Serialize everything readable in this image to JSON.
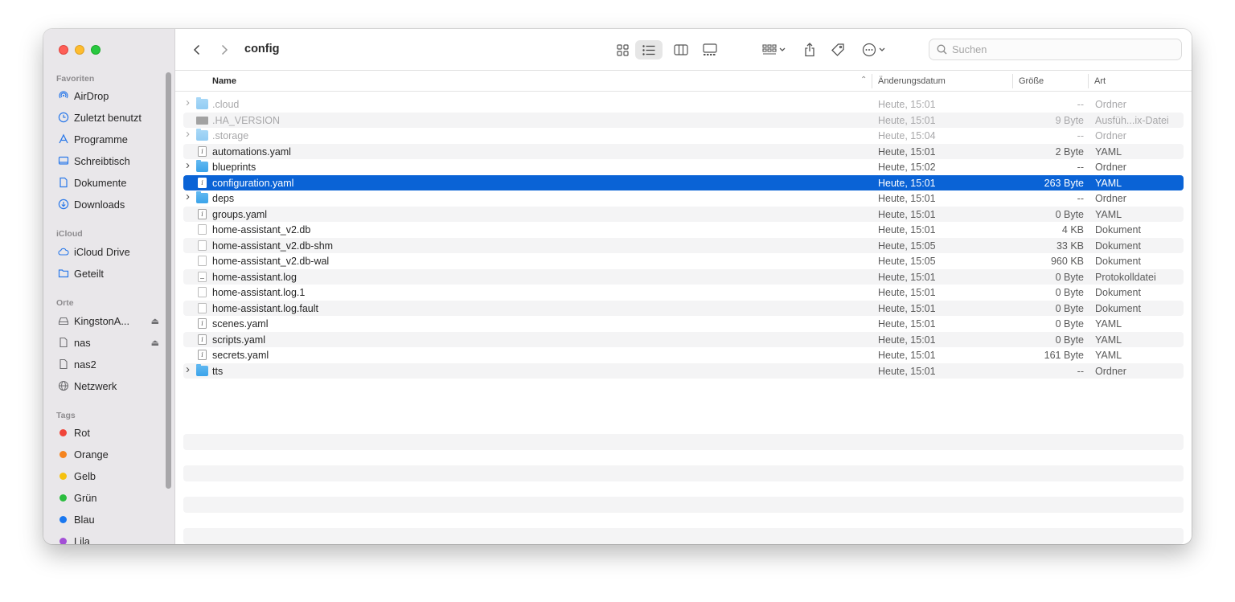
{
  "window": {
    "title": "config"
  },
  "sidebar": {
    "sections": [
      {
        "label": "Favoriten"
      },
      {
        "label": "iCloud"
      },
      {
        "label": "Orte"
      },
      {
        "label": "Tags"
      }
    ],
    "favorites": [
      {
        "label": "AirDrop",
        "icon": "airdrop-icon"
      },
      {
        "label": "Zuletzt benutzt",
        "icon": "clock-icon"
      },
      {
        "label": "Programme",
        "icon": "applications-icon"
      },
      {
        "label": "Schreibtisch",
        "icon": "desktop-icon"
      },
      {
        "label": "Dokumente",
        "icon": "document-icon"
      },
      {
        "label": "Downloads",
        "icon": "download-icon"
      }
    ],
    "icloud": [
      {
        "label": "iCloud Drive",
        "icon": "cloud-icon"
      },
      {
        "label": "Geteilt",
        "icon": "shared-folder-icon"
      }
    ],
    "places": [
      {
        "label": "KingstonA...",
        "icon": "drive-icon"
      },
      {
        "label": "nas",
        "icon": "server-icon"
      },
      {
        "label": "nas2",
        "icon": "server-icon"
      },
      {
        "label": "Netzwerk",
        "icon": "network-icon"
      }
    ],
    "tags": [
      {
        "label": "Rot",
        "color": "#f0453a"
      },
      {
        "label": "Orange",
        "color": "#f5841f"
      },
      {
        "label": "Gelb",
        "color": "#f5c10f"
      },
      {
        "label": "Grün",
        "color": "#2bbd3f"
      },
      {
        "label": "Blau",
        "color": "#1a78f0"
      },
      {
        "label": "Lila",
        "color": "#a34fd6"
      }
    ]
  },
  "toolbar": {
    "back_icon": "chevron-left-icon",
    "forward_icon": "chevron-right-icon",
    "search_placeholder": "Suchen"
  },
  "columns": {
    "name": "Name",
    "date": "Änderungsdatum",
    "size": "Größe",
    "kind": "Art"
  },
  "files": [
    {
      "name": ".cloud",
      "date": "Heute, 15:01",
      "size": "--",
      "kind": "Ordner",
      "type": "folder",
      "hidden": true,
      "expandable": true
    },
    {
      "name": ".HA_VERSION",
      "date": "Heute, 15:01",
      "size": "9 Byte",
      "kind": "Ausfüh...ix-Datei",
      "type": "exec",
      "hidden": true,
      "expandable": false
    },
    {
      "name": ".storage",
      "date": "Heute, 15:04",
      "size": "--",
      "kind": "Ordner",
      "type": "folder",
      "hidden": true,
      "expandable": true
    },
    {
      "name": "automations.yaml",
      "date": "Heute, 15:01",
      "size": "2 Byte",
      "kind": "YAML",
      "type": "yaml",
      "hidden": false,
      "expandable": false
    },
    {
      "name": "blueprints",
      "date": "Heute, 15:02",
      "size": "--",
      "kind": "Ordner",
      "type": "folder",
      "hidden": false,
      "expandable": true
    },
    {
      "name": "configuration.yaml",
      "date": "Heute, 15:01",
      "size": "263 Byte",
      "kind": "YAML",
      "type": "yaml",
      "hidden": false,
      "expandable": false,
      "selected": true
    },
    {
      "name": "deps",
      "date": "Heute, 15:01",
      "size": "--",
      "kind": "Ordner",
      "type": "folder",
      "hidden": false,
      "expandable": true
    },
    {
      "name": "groups.yaml",
      "date": "Heute, 15:01",
      "size": "0 Byte",
      "kind": "YAML",
      "type": "yaml",
      "hidden": false,
      "expandable": false
    },
    {
      "name": "home-assistant_v2.db",
      "date": "Heute, 15:01",
      "size": "4 KB",
      "kind": "Dokument",
      "type": "doc",
      "hidden": false,
      "expandable": false
    },
    {
      "name": "home-assistant_v2.db-shm",
      "date": "Heute, 15:05",
      "size": "33 KB",
      "kind": "Dokument",
      "type": "doc",
      "hidden": false,
      "expandable": false
    },
    {
      "name": "home-assistant_v2.db-wal",
      "date": "Heute, 15:05",
      "size": "960 KB",
      "kind": "Dokument",
      "type": "doc",
      "hidden": false,
      "expandable": false
    },
    {
      "name": "home-assistant.log",
      "date": "Heute, 15:01",
      "size": "0 Byte",
      "kind": "Protokolldatei",
      "type": "log",
      "hidden": false,
      "expandable": false
    },
    {
      "name": "home-assistant.log.1",
      "date": "Heute, 15:01",
      "size": "0 Byte",
      "kind": "Dokument",
      "type": "doc",
      "hidden": false,
      "expandable": false
    },
    {
      "name": "home-assistant.log.fault",
      "date": "Heute, 15:01",
      "size": "0 Byte",
      "kind": "Dokument",
      "type": "doc",
      "hidden": false,
      "expandable": false
    },
    {
      "name": "scenes.yaml",
      "date": "Heute, 15:01",
      "size": "0 Byte",
      "kind": "YAML",
      "type": "yaml",
      "hidden": false,
      "expandable": false
    },
    {
      "name": "scripts.yaml",
      "date": "Heute, 15:01",
      "size": "0 Byte",
      "kind": "YAML",
      "type": "yaml",
      "hidden": false,
      "expandable": false
    },
    {
      "name": "secrets.yaml",
      "date": "Heute, 15:01",
      "size": "161 Byte",
      "kind": "YAML",
      "type": "yaml",
      "hidden": false,
      "expandable": false
    },
    {
      "name": "tts",
      "date": "Heute, 15:01",
      "size": "--",
      "kind": "Ordner",
      "type": "folder",
      "hidden": false,
      "expandable": true
    }
  ],
  "colors": {
    "selection": "#0a63d6",
    "accent": "#2b79e9"
  }
}
